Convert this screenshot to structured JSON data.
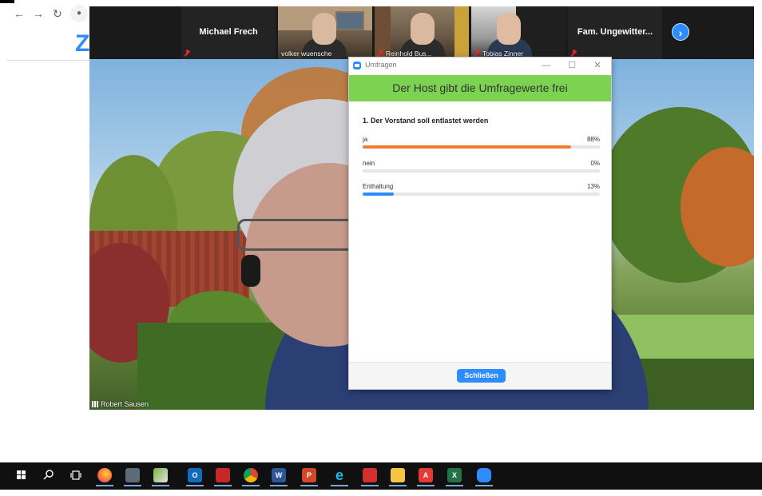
{
  "participants": [
    {
      "name": "Michael Frech",
      "muted": true
    },
    {
      "name": "volker wuensche"
    },
    {
      "name": "Reinhold Bus...",
      "muted": true
    },
    {
      "name": "Tobias Zinner",
      "muted": true
    },
    {
      "name": "Fam. Ungewitter...",
      "muted": true
    }
  ],
  "main_speaker": "Robert Sausen",
  "poll": {
    "window_title": "Umfragen",
    "banner": "Der Host gibt die Umfragewerte frei",
    "question": "1. Der Vorstand soll entlastet werden",
    "answers": [
      {
        "label": "ja",
        "percent_label": "88%",
        "value": 88,
        "color": "#ed7d31"
      },
      {
        "label": "nein",
        "percent_label": "0%",
        "value": 0,
        "color": "#2d8cff"
      },
      {
        "label": "Enthaltung",
        "percent_label": "13%",
        "value": 13,
        "color": "#2d8cff"
      }
    ],
    "close_label": "Schließen"
  },
  "colors": {
    "zoom_blue": "#2d8cff",
    "banner_green": "#7cd251",
    "bar_orange": "#ed7d31"
  },
  "icons": {
    "window_controls": [
      "minimize-icon",
      "maximize-icon",
      "close-icon"
    ],
    "taskbar": [
      "windows-start-icon",
      "search-icon",
      "task-view-icon",
      "firefox-icon",
      "photo-viewer-icon",
      "file-tool-icon",
      "outlook-icon",
      "media-icon",
      "chrome-icon",
      "word-icon",
      "powerpoint-icon",
      "internet-explorer-icon",
      "app-red-icon",
      "file-explorer-icon",
      "acrobat-icon",
      "excel-icon",
      "zoom-icon"
    ]
  }
}
